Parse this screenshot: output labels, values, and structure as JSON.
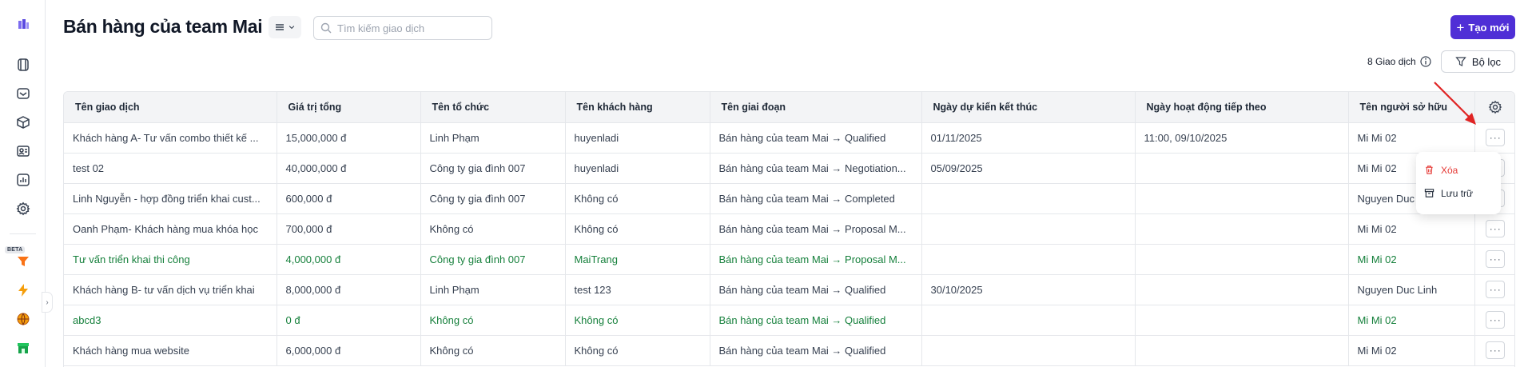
{
  "header": {
    "title": "Bán hàng của team Mai",
    "search_placeholder": "Tìm kiếm giao dịch",
    "create_label": "Tạo mới",
    "count_text": "8 Giao dịch",
    "filter_label": "Bộ lọc"
  },
  "sidebar": {
    "beta_label": "BETA"
  },
  "table": {
    "columns": [
      "Tên giao dịch",
      "Giá trị tổng",
      "Tên tổ chức",
      "Tên khách hàng",
      "Tên giai đoạn",
      "Ngày dự kiến kết thúc",
      "Ngày hoạt động tiếp theo",
      "Tên người sở hữu"
    ],
    "rows": [
      {
        "deal": "Khách hàng A- Tư vấn combo thiết kế ...",
        "value": "15,000,000 đ",
        "org": "Linh Phạm",
        "customer": "huyenladi",
        "stage": "Bán hàng của team Mai → Qualified",
        "close_date": "01/11/2025",
        "next_activity": "11:00, 09/10/2025",
        "owner": "Mi Mi 02",
        "highlight": false
      },
      {
        "deal": "test 02",
        "value": "40,000,000 đ",
        "org": "Công ty gia đình 007",
        "customer": "huyenladi",
        "stage": "Bán hàng của team Mai → Negotiation...",
        "close_date": "05/09/2025",
        "next_activity": "",
        "owner": "Mi Mi 02",
        "highlight": false
      },
      {
        "deal": "Linh Nguyễn - hợp đồng triển khai cust...",
        "value": "600,000 đ",
        "org": "Công ty gia đình 007",
        "customer": "Không có",
        "stage": "Bán hàng của team Mai → Completed",
        "close_date": "",
        "next_activity": "",
        "owner": "Nguyen Duc",
        "highlight": false
      },
      {
        "deal": "Oanh Phạm- Khách hàng mua khóa học",
        "value": "700,000 đ",
        "org": "Không có",
        "customer": "Không có",
        "stage": "Bán hàng của team Mai → Proposal M...",
        "close_date": "",
        "next_activity": "",
        "owner": "Mi Mi 02",
        "highlight": false
      },
      {
        "deal": "Tư vấn triển khai thi công",
        "value": "4,000,000 đ",
        "org": "Công ty gia đình 007",
        "customer": "MaiTrang",
        "stage": "Bán hàng của team Mai → Proposal M...",
        "close_date": "",
        "next_activity": "",
        "owner": "Mi Mi 02",
        "highlight": true
      },
      {
        "deal": "Khách hàng B- tư vấn dịch vụ triển khai",
        "value": "8,000,000 đ",
        "org": "Linh Phạm",
        "customer": "test 123",
        "stage": "Bán hàng của team Mai → Qualified",
        "close_date": "30/10/2025",
        "next_activity": "",
        "owner": "Nguyen Duc Linh",
        "highlight": false
      },
      {
        "deal": "abcd3",
        "value": "0 đ",
        "org": "Không có",
        "customer": "Không có",
        "stage": "Bán hàng của team Mai → Qualified",
        "close_date": "",
        "next_activity": "",
        "owner": "Mi Mi 02",
        "highlight": true
      },
      {
        "deal": "Khách hàng mua website",
        "value": "6,000,000 đ",
        "org": "Không có",
        "customer": "Không có",
        "stage": "Bán hàng của team Mai → Qualified",
        "close_date": "",
        "next_activity": "",
        "owner": "Mi Mi 02",
        "highlight": false
      }
    ],
    "more_label": "···"
  },
  "context_menu": {
    "delete_label": "Xóa",
    "archive_label": "Lưu trữ"
  },
  "colors": {
    "accent": "#4f2fd6",
    "highlight_text": "#16803c",
    "delete": "#e53935",
    "annotation_arrow": "#e02424"
  }
}
